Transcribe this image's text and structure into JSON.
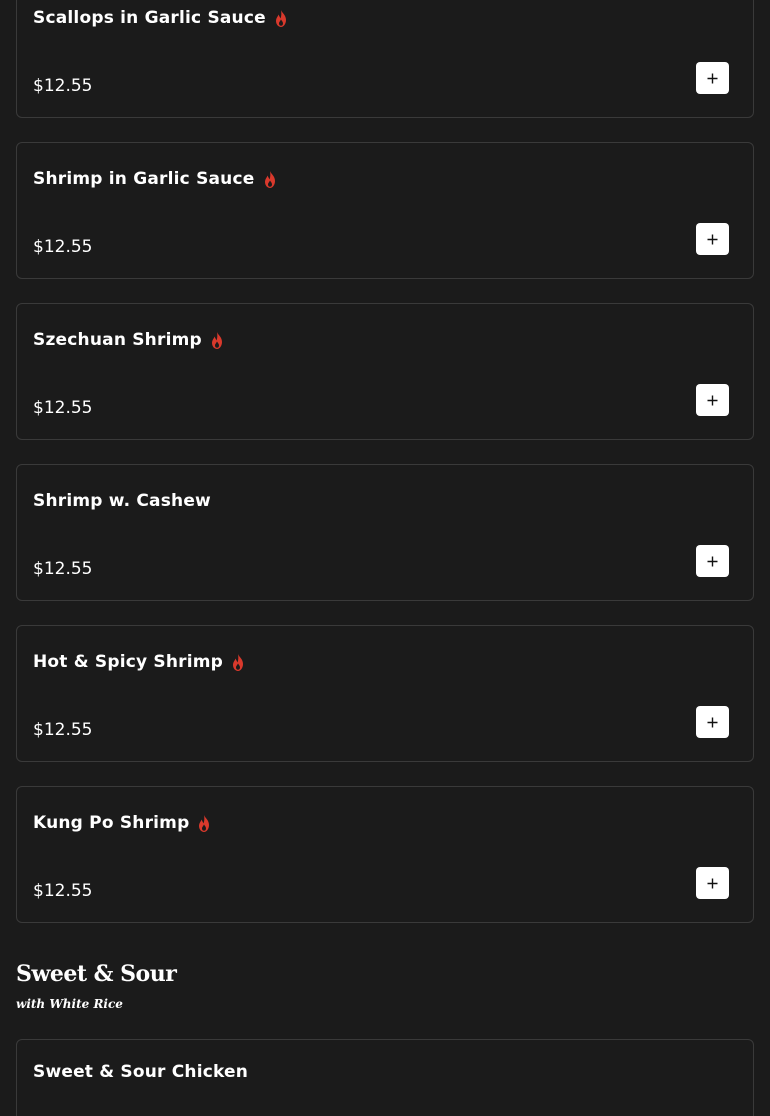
{
  "menu_items": [
    {
      "name": "Scallops in Garlic Sauce",
      "spicy": true,
      "price": "$12.55"
    },
    {
      "name": "Shrimp in Garlic Sauce",
      "spicy": true,
      "price": "$12.55"
    },
    {
      "name": "Szechuan Shrimp",
      "spicy": true,
      "price": "$12.55"
    },
    {
      "name": "Shrimp w. Cashew",
      "spicy": false,
      "price": "$12.55"
    },
    {
      "name": "Hot & Spicy Shrimp",
      "spicy": true,
      "price": "$12.55"
    },
    {
      "name": "Kung Po Shrimp",
      "spicy": true,
      "price": "$12.55"
    }
  ],
  "section": {
    "title": "Sweet & Sour",
    "subtitle": "with White Rice"
  },
  "next_item": {
    "name": "Sweet & Sour Chicken"
  },
  "icons": {
    "spicy": "flame-icon",
    "add": "plus-icon"
  },
  "colors": {
    "background": "#1b1b1b",
    "card_border": "#3a3a3a",
    "flame": "#d9392c",
    "add_button": "#ffffff"
  }
}
